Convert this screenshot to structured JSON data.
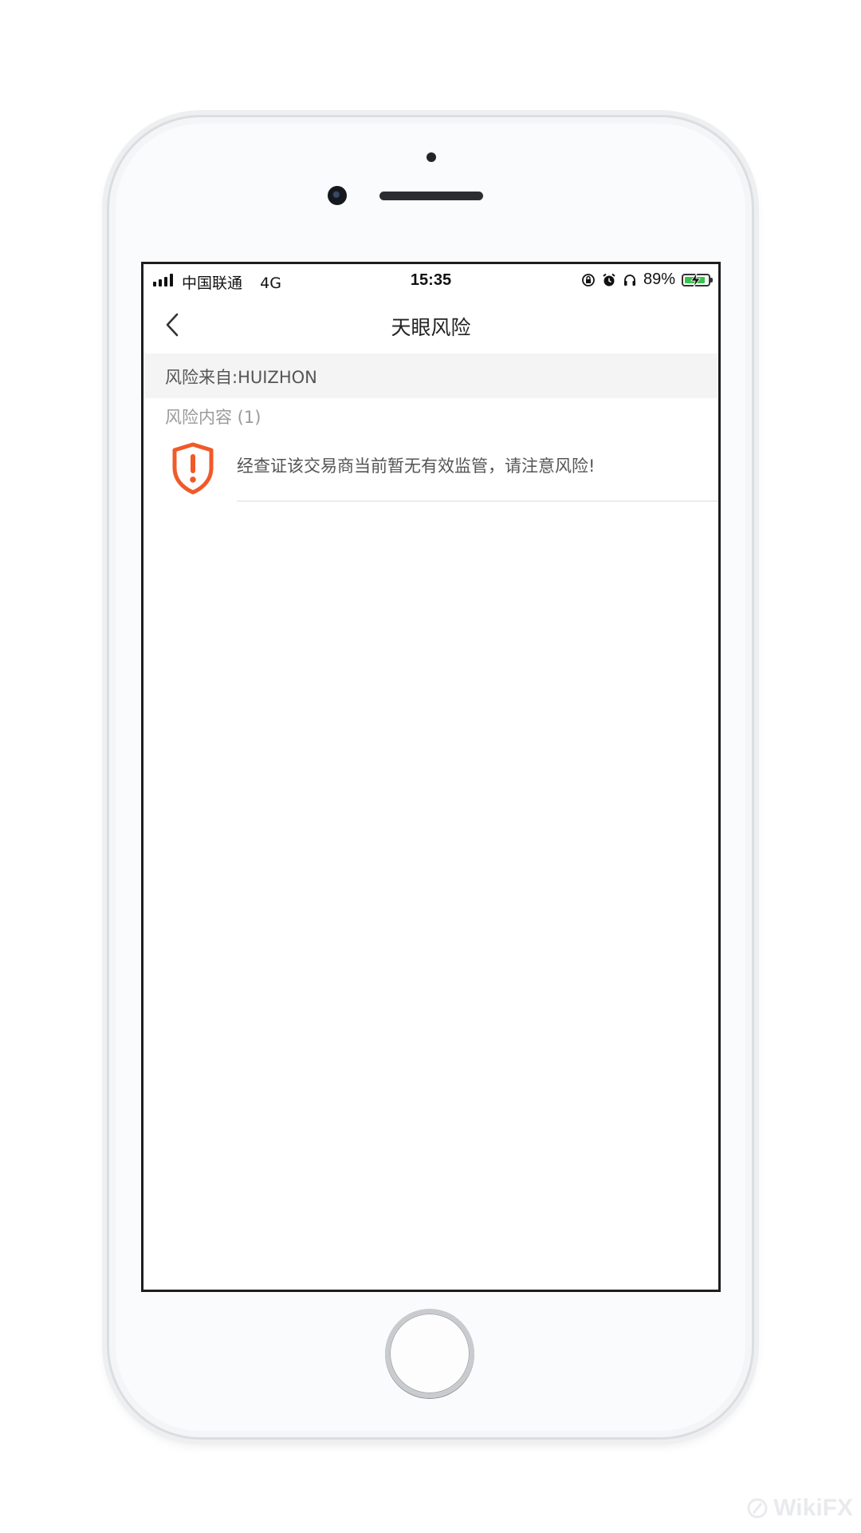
{
  "status_bar": {
    "carrier": "中国联通",
    "network": "4G",
    "time": "15:35",
    "battery_percent": "89%",
    "battery_level": 0.89,
    "icons": [
      "orientation-lock-icon",
      "alarm-icon",
      "headphones-icon"
    ],
    "battery_color": "#39c34c"
  },
  "nav": {
    "title": "天眼风险",
    "back_icon": "chevron-left-icon"
  },
  "risk": {
    "source_label": "风险来自:HUIZHON",
    "content_header": "风险内容 (1)",
    "items": [
      {
        "icon": "warning-shield-icon",
        "text": "经查证该交易商当前暂无有效监管，请注意风险!"
      }
    ],
    "accent_color": "#f05a28"
  },
  "watermark": {
    "text": "WikiFX"
  }
}
